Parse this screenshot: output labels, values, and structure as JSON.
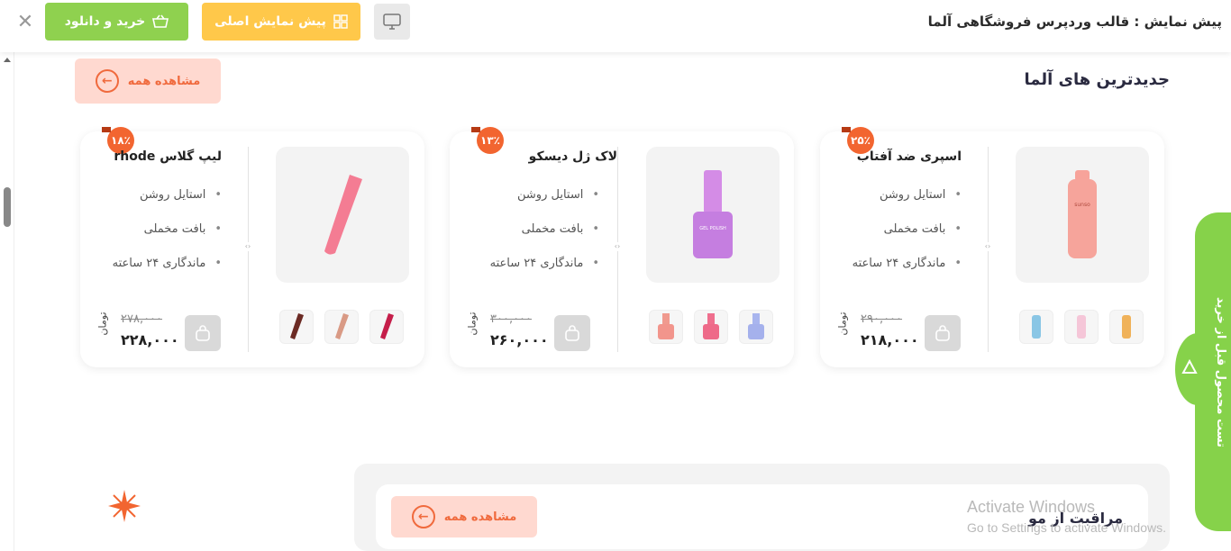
{
  "topbar": {
    "title": "پیش نمایش : قالب وردپرس فروشگاهی آلما",
    "buy_label": "خرید و دانلود",
    "preview_label": "پیش نمایش اصلی",
    "close_glyph": "✕"
  },
  "section": {
    "title": "جدیدترین های آلما",
    "see_all": "مشاهده همه"
  },
  "products": [
    {
      "badge": "۲۵٪",
      "name": "اسپری ضد آفتاب",
      "features": [
        "استایل روشن",
        "بافت مخملی",
        "ماندگاری ۲۴ ساعته"
      ],
      "old_price": "۲۹۰,۰۰۰",
      "price": "۲۱۸,۰۰۰",
      "currency": "تومان"
    },
    {
      "badge": "۱۳٪",
      "name": "لاک ژل دیسکو",
      "features": [
        "استایل روشن",
        "بافت مخملی",
        "ماندگاری ۲۴ ساعته"
      ],
      "old_price": "۳۰۰,۰۰۰",
      "price": "۲۶۰,۰۰۰",
      "currency": "تومان"
    },
    {
      "badge": "۱۸٪",
      "name": "لیپ گلاس rhode",
      "features": [
        "استایل روشن",
        "بافت مخملی",
        "ماندگاری ۲۴ ساعته"
      ],
      "old_price": "۲۷۸,۰۰۰",
      "price": "۲۲۸,۰۰۰",
      "currency": "تومان"
    }
  ],
  "side_tab": {
    "label": "تست محصول قبل از خرید"
  },
  "section2": {
    "title": "مراقبت از مو",
    "see_all": "مشاهده همه"
  },
  "watermark": {
    "line1": "Activate Windows",
    "line2": "Go to Settings to activate Windows."
  },
  "colors": {
    "accent": "#f26530",
    "green": "#8fd14f",
    "yellow": "#ffc84a"
  }
}
